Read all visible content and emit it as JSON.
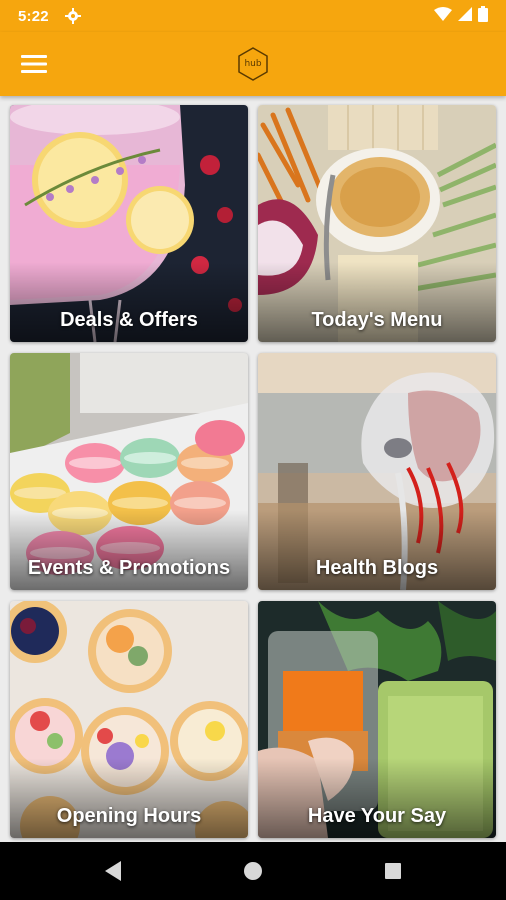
{
  "status_bar": {
    "time": "5:22"
  },
  "app_bar": {
    "logo_text": "hub"
  },
  "tiles": [
    {
      "label": "Deals & Offers"
    },
    {
      "label": "Today's Menu"
    },
    {
      "label": "Events & Promotions"
    },
    {
      "label": "Health Blogs"
    },
    {
      "label": "Opening Hours"
    },
    {
      "label": "Have Your Say"
    }
  ],
  "colors": {
    "accent": "#f6a60e",
    "nav": "#000000"
  },
  "icons": {
    "status": [
      "gear-icon",
      "wifi-icon",
      "signal-icon",
      "battery-icon"
    ],
    "app_bar": [
      "hamburger-menu-icon",
      "hub-logo-icon"
    ],
    "nav": [
      "back-icon",
      "home-icon",
      "recents-icon"
    ]
  }
}
